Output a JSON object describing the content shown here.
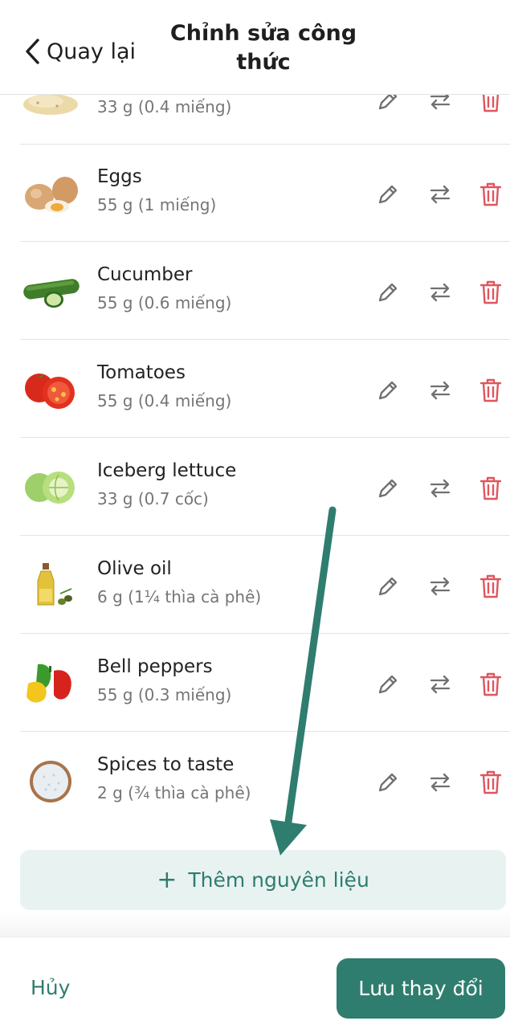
{
  "header": {
    "back_label": "Quay lại",
    "title": "Chỉnh sửa công thức"
  },
  "ingredients": [
    {
      "name": "",
      "qty": "33 g (0.4 miếng)",
      "icon": "tortilla-image"
    },
    {
      "name": "Eggs",
      "qty": "55 g (1 miếng)",
      "icon": "eggs-image"
    },
    {
      "name": "Cucumber",
      "qty": "55 g (0.6 miếng)",
      "icon": "cucumber-image"
    },
    {
      "name": "Tomatoes",
      "qty": "55 g (0.4 miếng)",
      "icon": "tomatoes-image"
    },
    {
      "name": "Iceberg lettuce",
      "qty": "33 g (0.7 cốc)",
      "icon": "lettuce-image"
    },
    {
      "name": "Olive oil",
      "qty": "6 g (1¼ thìa cà phê)",
      "icon": "olive-oil-image"
    },
    {
      "name": "Bell peppers",
      "qty": "55 g (0.3 miếng)",
      "icon": "bell-peppers-image"
    },
    {
      "name": "Spices to taste",
      "qty": "2 g (¾ thìa cà phê)",
      "icon": "salt-bowl-image"
    }
  ],
  "add_button": {
    "label": "Thêm nguyên liệu",
    "icon": "plus-icon"
  },
  "footer": {
    "cancel_label": "Hủy",
    "save_label": "Lưu thay đổi"
  },
  "colors": {
    "accent": "#2f7d6f",
    "accent_light": "#e8f3f1",
    "delete": "#e0555e",
    "icon_gray": "#707070"
  }
}
